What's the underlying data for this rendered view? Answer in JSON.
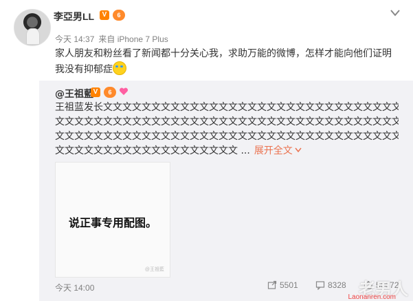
{
  "post": {
    "username": "李亞男LL",
    "verified_badge": "V",
    "vip_badge": "6",
    "time": "今天 14:37",
    "source": "来自 iPhone 7 Plus",
    "content_lines": [
      "家人朋友和粉丝看了新闻都十分关心我，求助万能的微博，怎样才能向他们证明",
      "我没有抑郁症"
    ],
    "content_emoji": "crying-laughing-emoji"
  },
  "repost": {
    "at_user": "@王祖藍",
    "verified_badge": "V",
    "vip_badge": "6",
    "text_lines": [
      "王祖蓝发长文文文文文文文文文文文文文文文文文文文文文文文文文文文文文文文文",
      "文文文文文文文文文文文文文文文文文文文文文文文文文文文文文文文文文文文文文文文文文文",
      "文文文文文文文文文文文文文文文文文文文文文文文文文文文文文文文文文文文文文文文文文",
      "文文文文文文文文文文文文文文文文文文文 ..."
    ],
    "expand_label": "展开全文",
    "image_caption": "说正事专用配图。",
    "image_watermark": "@王祖藍",
    "time": "今天 14:00",
    "shares": "5501",
    "comments": "8328",
    "likes": "50672"
  },
  "watermark": {
    "logo": "老男人",
    "url": "Laonanren.com"
  },
  "colors": {
    "orange": "#ff8200",
    "link": "#eb7350",
    "repost_bg": "#f2f2f5"
  }
}
